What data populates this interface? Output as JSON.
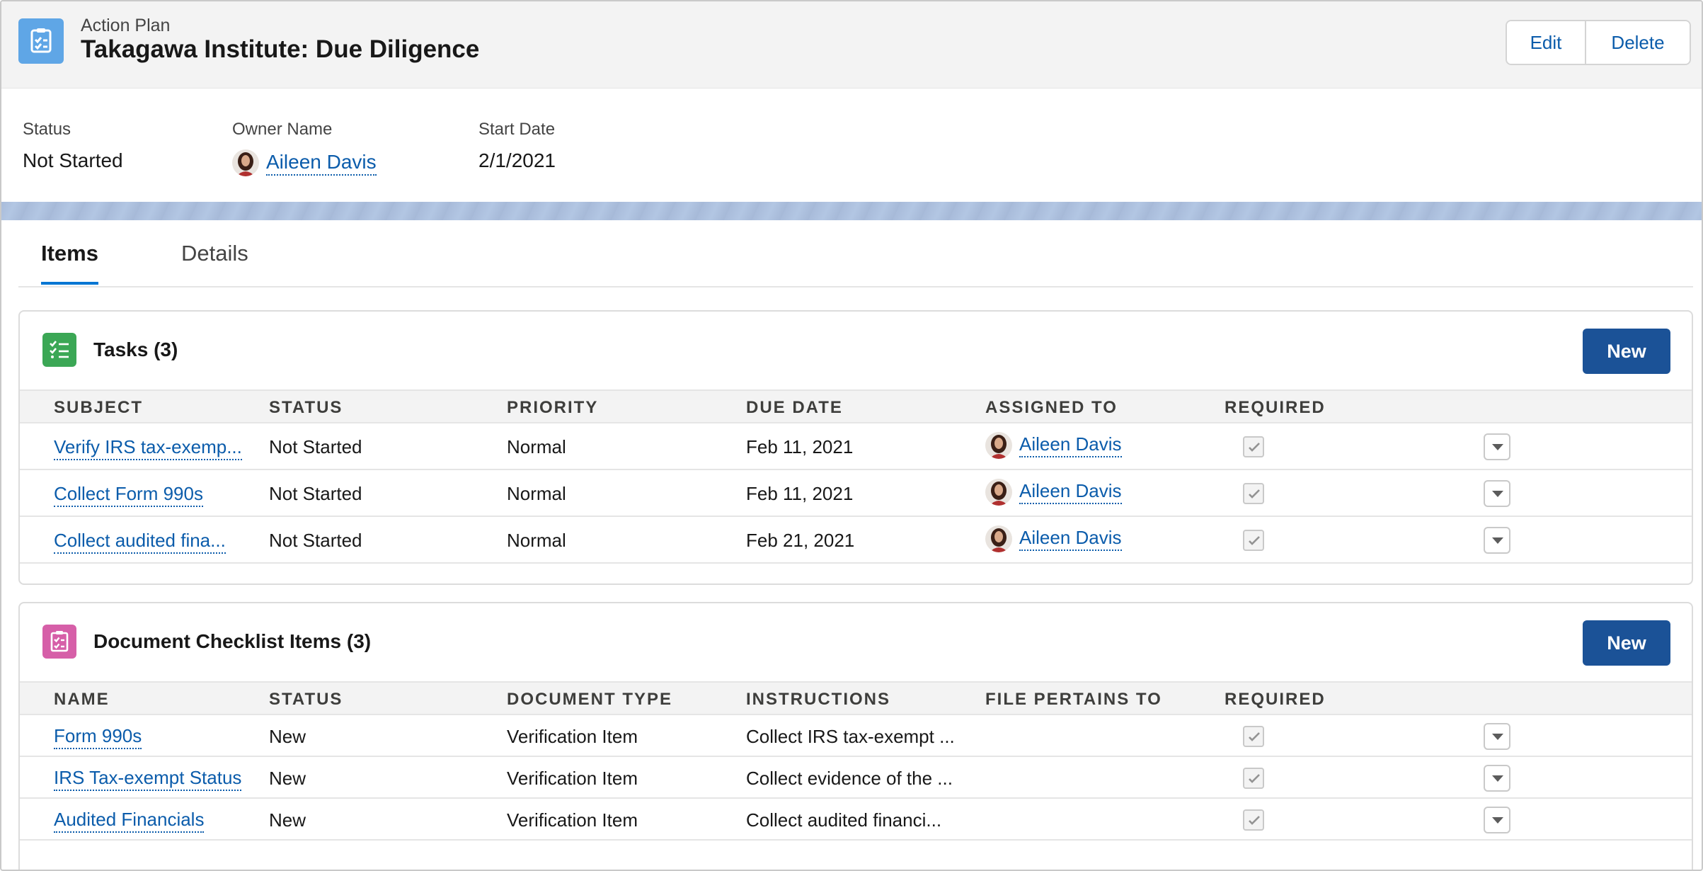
{
  "header": {
    "object_type": "Action Plan",
    "title": "Takagawa Institute: Due Diligence",
    "edit_label": "Edit",
    "delete_label": "Delete",
    "icon": "checklist-icon",
    "icon_color": "#5fa6e6"
  },
  "highlights": {
    "status_label": "Status",
    "status_value": "Not Started",
    "owner_label": "Owner Name",
    "owner_value": "Aileen Davis",
    "start_label": "Start Date",
    "start_value": "2/1/2021"
  },
  "tabs": [
    {
      "label": "Items",
      "active": true
    },
    {
      "label": "Details",
      "active": false
    }
  ],
  "tasks": {
    "title": "Tasks (3)",
    "new_label": "New",
    "icon_color": "#3ba755",
    "columns": [
      "SUBJECT",
      "STATUS",
      "PRIORITY",
      "DUE DATE",
      "ASSIGNED TO",
      "REQUIRED"
    ],
    "rows": [
      {
        "subject": "Verify IRS tax-exemp...",
        "status": "Not Started",
        "priority": "Normal",
        "due": "Feb 11, 2021",
        "assigned": "Aileen Davis",
        "required": true
      },
      {
        "subject": "Collect Form 990s",
        "status": "Not Started",
        "priority": "Normal",
        "due": "Feb 11, 2021",
        "assigned": "Aileen Davis",
        "required": true
      },
      {
        "subject": "Collect audited fina...",
        "status": "Not Started",
        "priority": "Normal",
        "due": "Feb 21, 2021",
        "assigned": "Aileen Davis",
        "required": true
      }
    ]
  },
  "documents": {
    "title": "Document Checklist Items (3)",
    "new_label": "New",
    "icon_color": "#d65fa8",
    "columns": [
      "NAME",
      "STATUS",
      "DOCUMENT TYPE",
      "INSTRUCTIONS",
      "FILE PERTAINS TO",
      "REQUIRED"
    ],
    "rows": [
      {
        "name": "Form 990s",
        "status": "New",
        "type": "Verification Item",
        "instructions": "Collect IRS tax-exempt ...",
        "pertains": "",
        "required": true
      },
      {
        "name": "IRS Tax-exempt Status",
        "status": "New",
        "type": "Verification Item",
        "instructions": "Collect evidence of the ...",
        "pertains": "",
        "required": true
      },
      {
        "name": "Audited Financials",
        "status": "New",
        "type": "Verification Item",
        "instructions": "Collect audited financi...",
        "pertains": "",
        "required": true
      }
    ]
  },
  "accent_color": "#0176d3",
  "link_color": "#0b5cab",
  "button_color": "#1b5297"
}
